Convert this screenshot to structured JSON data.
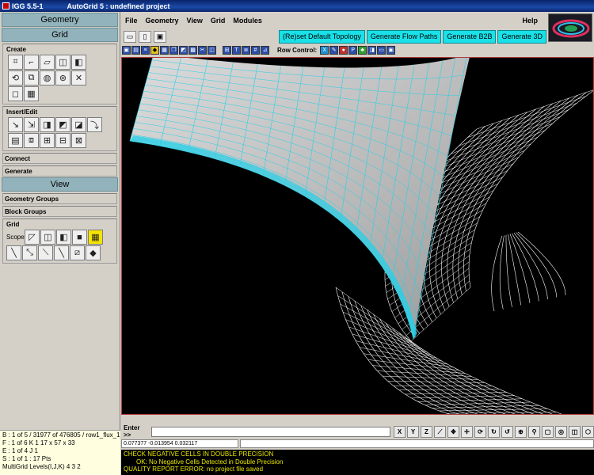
{
  "window": {
    "app_version": "IGG 5.5-1",
    "title": "AutoGrid 5 : undefined project"
  },
  "left_panel": {
    "geometry_header": "Geometry",
    "grid_header": "Grid",
    "create_title": "Create",
    "insert_edit_title": "Insert/Edit",
    "connect_title": "Connect",
    "generate_title": "Generate",
    "view_header": "View",
    "geometry_groups_title": "Geometry Groups",
    "block_groups_title": "Block Groups",
    "grid_title": "Grid",
    "scope_label": "Scope:"
  },
  "status": {
    "line1": "B : 1 of 5 / 31977 of 476805 / row1_flux_1_",
    "line2": "F : 1 of 6   K  1    17 x 57 x 33",
    "line3": "E : 1 of 4   J  1",
    "line4": "S : 1 of 1 : 17 Pts",
    "line5": "MultiGrid Levels(I,J,K) 4 3 2"
  },
  "menu": {
    "file": "File",
    "geometry": "Geometry",
    "view": "View",
    "grid": "Grid",
    "modules": "Modules",
    "help": "Help"
  },
  "toolbar": {
    "reset_topology": "(Re)set Default Topology",
    "flow_paths": "Generate Flow Paths",
    "b2b": "Generate B2B",
    "gen3d": "Generate 3D",
    "row_control": "Row Control:"
  },
  "command": {
    "enter_label": "Enter >>",
    "x_btn": "X",
    "y_btn": "Y",
    "z_btn": "Z"
  },
  "coords": {
    "readout": "0.077377  -0.013954  0.032117"
  },
  "messages": {
    "line1": "CHECK NEGATIVE CELLS IN DOUBLE PRECISION",
    "line2": "OK: No Negative Cells Detected in Double Precision",
    "line3": "QUALITY REPORT ERROR: no project file saved"
  },
  "icons": {
    "create_row1": [
      "vertex-icon",
      "edge-icon",
      "face-icon",
      "block-icon",
      "block-copy-icon"
    ],
    "create_row2": [
      "rotate-icon",
      "periodic-icon",
      "sphere-icon",
      "torus-icon",
      "delete-icon"
    ],
    "create_row3": [
      "cube-icon",
      "cube-grid-icon"
    ],
    "insert_row1": [
      "insert-vertex-icon",
      "insert-fixed-icon",
      "split-face-icon",
      "split-block-icon",
      "merge-block-icon",
      "edge-curve-icon"
    ],
    "insert_row2": [
      "block-stack-icon",
      "block-link-icon",
      "block-split-icon",
      "block-grid-icon",
      "block-merge-icon"
    ],
    "grid_scope": [
      "scope-vertex-icon",
      "scope-face-icon",
      "scope-block-icon",
      "scope-all-icon",
      "scope-active-icon"
    ],
    "grid_row2": [
      "line-icon",
      "polyline-icon",
      "spline-icon",
      "diagonal-icon",
      "mesh-icon",
      "solid-icon"
    ]
  },
  "colors": {
    "accent_cyan": "#1ae0e8",
    "section_header": "#92b3bb",
    "message_text": "#e8e800",
    "mesh_cyan": "#28d0e8",
    "mesh_white": "#ffffff"
  }
}
